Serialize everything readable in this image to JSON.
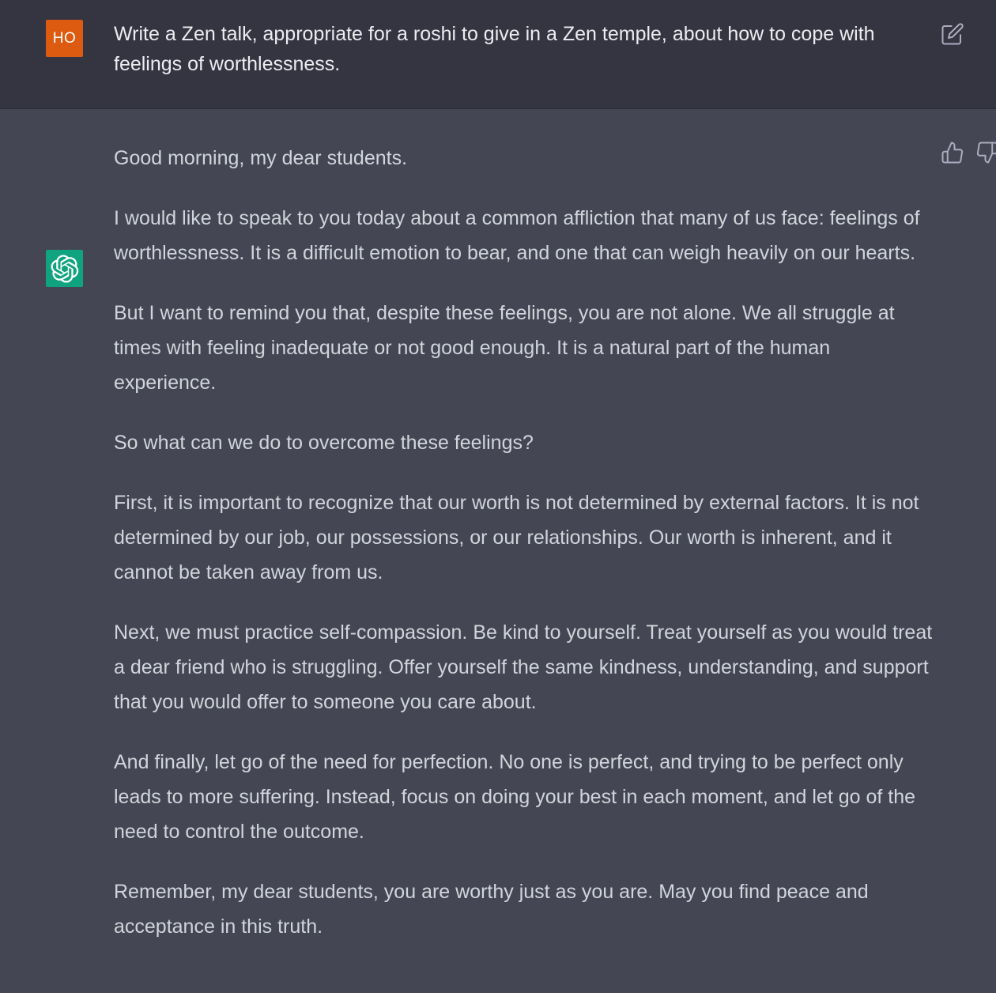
{
  "user_message": {
    "avatar_initials": "HO",
    "avatar_color": "#dd5b10",
    "text": "Write a Zen talk, appropriate for a roshi to give in a Zen temple, about how to cope with feelings of worthlessness.",
    "edit_icon": "edit-icon"
  },
  "assistant_message": {
    "avatar_icon": "openai-logo-icon",
    "avatar_color": "#10a37f",
    "paragraphs": [
      "Good morning, my dear students.",
      "I would like to speak to you today about a common affliction that many of us face: feelings of worthlessness. It is a difficult emotion to bear, and one that can weigh heavily on our hearts.",
      "But I want to remind you that, despite these feelings, you are not alone. We all struggle at times with feeling inadequate or not good enough. It is a natural part of the human experience.",
      "So what can we do to overcome these feelings?",
      "First, it is important to recognize that our worth is not determined by external factors. It is not determined by our job, our possessions, or our relationships. Our worth is inherent, and it cannot be taken away from us.",
      "Next, we must practice self-compassion. Be kind to yourself. Treat yourself as you would treat a dear friend who is struggling. Offer yourself the same kindness, understanding, and support that you would offer to someone you care about.",
      "And finally, let go of the need for perfection. No one is perfect, and trying to be perfect only leads to more suffering. Instead, focus on doing your best in each moment, and let go of the need to control the outcome.",
      "Remember, my dear students, you are worthy just as you are. May you find peace and acceptance in this truth."
    ],
    "feedback_icons": [
      "thumbs-up-icon",
      "thumbs-down-icon"
    ]
  }
}
